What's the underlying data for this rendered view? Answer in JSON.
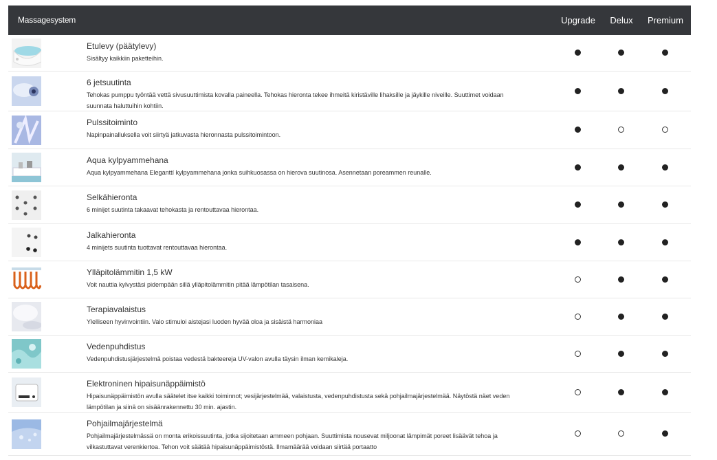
{
  "header": {
    "title": "Massagesystem",
    "columns": [
      "Upgrade",
      "Delux",
      "Premium"
    ]
  },
  "rows": [
    {
      "name": "Etulevy (päätylevy)",
      "desc": "Sisältyy kaikkiin paketteihin.",
      "desc2": "",
      "icon": "front-panel-thumbnail-icon",
      "avail": [
        true,
        true,
        true
      ]
    },
    {
      "name": "6 jetsuutinta",
      "desc": "Tehokas pumppu työntää vettä sivusuuttimista kovalla paineella. Tehokas hieronta tekee ihmeitä kiristäville lihaksille ja jäykille niveille. Suuttimet voidaan",
      "desc2": "suunnata haluttuihin kohtiin.",
      "icon": "jet-nozzle-thumbnail-icon",
      "avail": [
        true,
        true,
        true
      ]
    },
    {
      "name": "Pulssitoiminto",
      "desc": "Napinpainalluksella voit siirtyä jatkuvasta hieronnasta pulssitoimintoon.",
      "desc2": "",
      "icon": "pulse-thumbnail-icon",
      "avail": [
        true,
        false,
        false
      ]
    },
    {
      "name": "Aqua kylpyammehana",
      "desc": "Aqua kylpyammehana Eleganttí kylpyammehana jonka suihkuosassa on hierova suutinosa. Asennetaan poreammen reunalle.",
      "desc2": "",
      "icon": "faucet-thumbnail-icon",
      "avail": [
        true,
        true,
        true
      ]
    },
    {
      "name": "Selkähieronta",
      "desc": "6 minijet suutinta takaavat tehokasta ja rentouttavaa hierontaa.",
      "desc2": "",
      "icon": "back-massage-thumbnail-icon",
      "avail": [
        true,
        true,
        true
      ]
    },
    {
      "name": "Jalkahieronta",
      "desc": "4 minijets suutinta tuottavat rentouttavaa hierontaa.",
      "desc2": "",
      "icon": "foot-massage-thumbnail-icon",
      "avail": [
        true,
        true,
        true
      ]
    },
    {
      "name": "Ylläpitolämmitin 1,5 kW",
      "desc": "Voit nauttia kylvystäsi pidempään sillä ylläpitolämmitin pitää lämpötilan tasaisena.",
      "desc2": "",
      "icon": "heater-coil-thumbnail-icon",
      "avail": [
        false,
        true,
        true
      ]
    },
    {
      "name": "Terapiavalaistus",
      "desc": "Ylelliseen hyvinvointiin. Valo stimuloi aistejasi luoden hyvää oloa ja sisäistä harmoniaa",
      "desc2": "",
      "icon": "therapy-light-thumbnail-icon",
      "avail": [
        false,
        true,
        true
      ]
    },
    {
      "name": "Vedenpuhdistus",
      "desc": "Vedenpuhdistusjärjestelmä poistaa vedestä bakteereja UV-valon avulla täysin ilman kemikaleja.",
      "desc2": "",
      "icon": "water-purification-thumbnail-icon",
      "avail": [
        false,
        true,
        true
      ]
    },
    {
      "name": "Elektroninen hipaisunäppäimistö",
      "desc": "Hipaisunäppäimistön avulla säätelet itse kaikki toiminnot; vesijärjestelmää, valaistusta, vedenpuhdistusta sekä pohjailmajärjestelmää. Näytöstä näet veden",
      "desc2": "lämpötilan ja siinä on sisäänrakennettu 30 min. ajastin.",
      "icon": "touch-keypad-thumbnail-icon",
      "avail": [
        false,
        true,
        true
      ]
    },
    {
      "name": "Pohjailmajärjestelmä",
      "desc": "Pohjailmajärjestelmässä on monta erikoissuutinta, jotka sijoitetaan ammeen pohjaan. Suuttimista nousevat miljoonat lämpimät poreet lisäävät tehoa ja",
      "desc2": "vilkastuttavat verenkiertoa. Tehon voit säätää hipaisunäppäimistöstä. Ilmamäärää voidaan siirtää portaatto",
      "icon": "bottom-air-thumbnail-icon",
      "avail": [
        false,
        false,
        true
      ]
    }
  ],
  "colors": {
    "header_bg": "#35373b",
    "header_text": "#ffffff",
    "dot_on": "#222222"
  }
}
